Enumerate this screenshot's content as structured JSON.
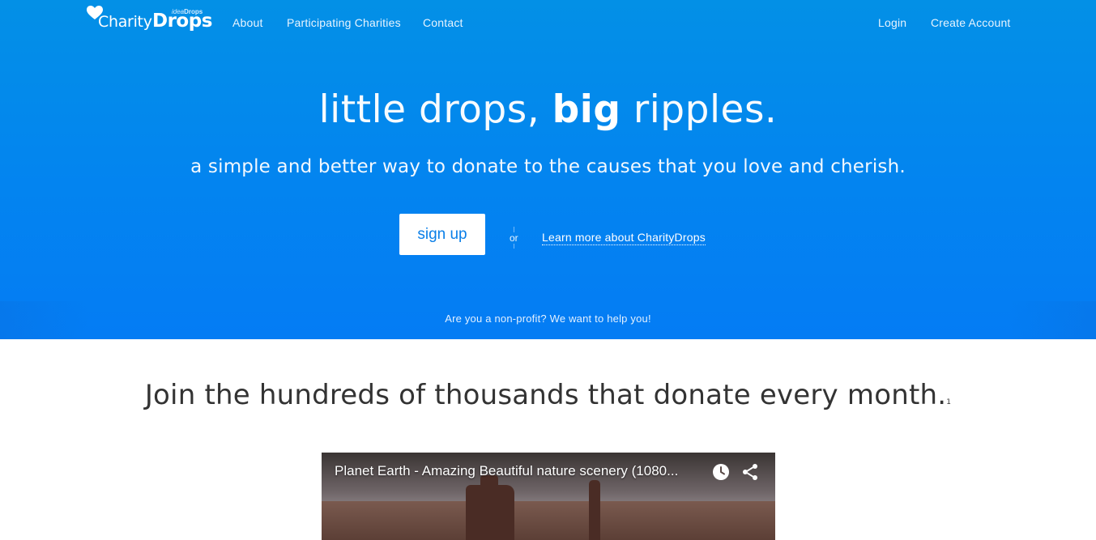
{
  "brand": {
    "name_part1": "Charity",
    "name_part2": "Drops",
    "sub_part1": "idea",
    "sub_part2": "Drops"
  },
  "nav": {
    "left": [
      "About",
      "Participating Charities",
      "Contact"
    ],
    "right": [
      "Login",
      "Create Account"
    ]
  },
  "hero": {
    "headline_pre": "little drops, ",
    "headline_bold": "big",
    "headline_post": " ripples.",
    "subhead": "a simple and better way to donate to the causes that you love and cherish.",
    "signup_label": "sign up",
    "or_label": "or",
    "learn_more_label": "Learn more about CharityDrops",
    "nonprofit_text": "Are you a non-profit? We want to help you!"
  },
  "section": {
    "join_text": "Join the hundreds of thousands that donate every month.",
    "join_footnote": "1"
  },
  "video": {
    "title": "Planet Earth - Amazing Beautiful nature scenery (1080...",
    "icons": [
      "clock-icon",
      "share-icon"
    ]
  },
  "colors": {
    "hero_top": "#0390e6",
    "hero_bottom": "#047cf4",
    "signup_text": "#0a7fe8",
    "body_text": "#333333"
  }
}
